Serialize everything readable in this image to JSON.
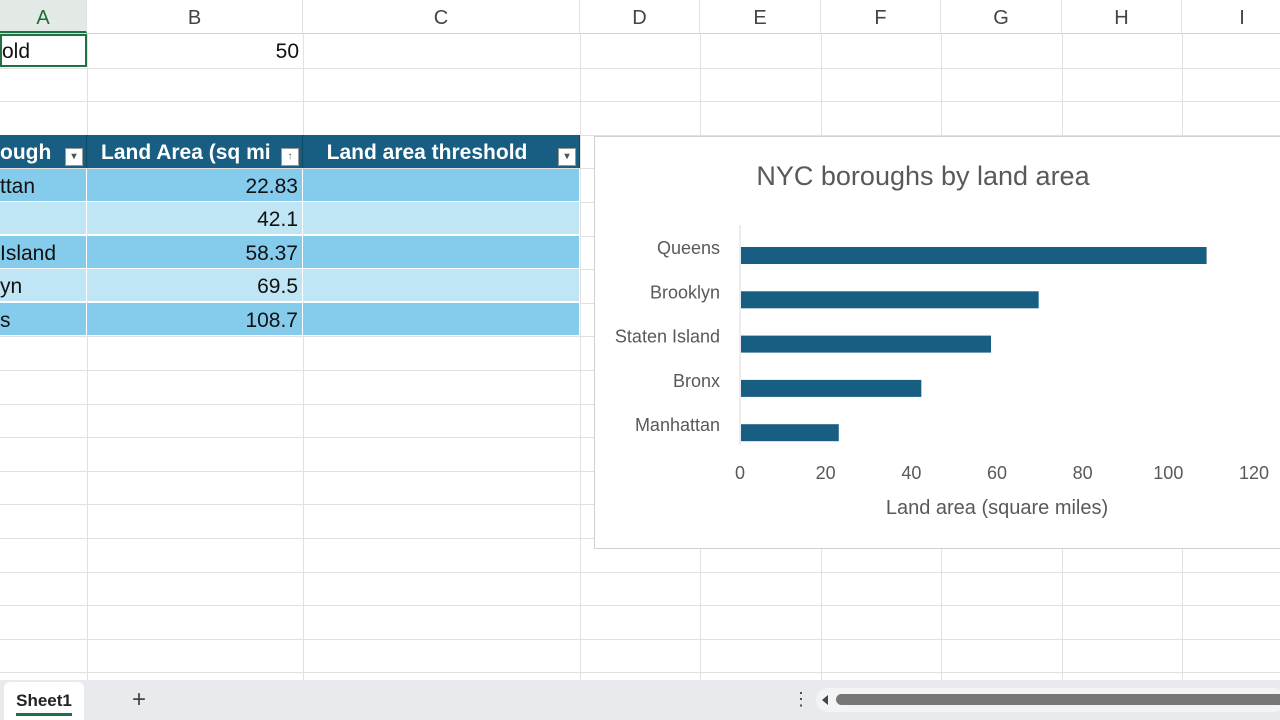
{
  "columns": [
    "A",
    "B",
    "C",
    "D",
    "E",
    "F",
    "G",
    "H",
    "I"
  ],
  "cells": {
    "a1": "old",
    "b1": "50"
  },
  "table": {
    "headers": [
      "ough",
      "Land Area (sq mi",
      "Land area threshold"
    ],
    "rows": [
      [
        "ttan",
        "22.83",
        ""
      ],
      [
        "",
        "42.1",
        ""
      ],
      [
        " Island",
        "58.37",
        ""
      ],
      [
        "yn",
        "69.5",
        ""
      ],
      [
        "s",
        "108.7",
        ""
      ]
    ]
  },
  "chart_data": {
    "type": "bar",
    "orientation": "horizontal",
    "title": "NYC boroughs by land area",
    "categories": [
      "Queens",
      "Brooklyn",
      "Staten Island",
      "Bronx",
      "Manhattan"
    ],
    "values": [
      108.7,
      69.5,
      58.37,
      42.1,
      22.83
    ],
    "xlabel": "Land area (square miles)",
    "ylabel": "",
    "xlim": [
      0,
      120
    ],
    "xticks": [
      "0",
      "20",
      "40",
      "60",
      "80",
      "100",
      "120"
    ],
    "color": "#175e82",
    "grid": false
  },
  "tabs": {
    "sheet1": "Sheet1",
    "add": "+",
    "more": "⋮"
  }
}
